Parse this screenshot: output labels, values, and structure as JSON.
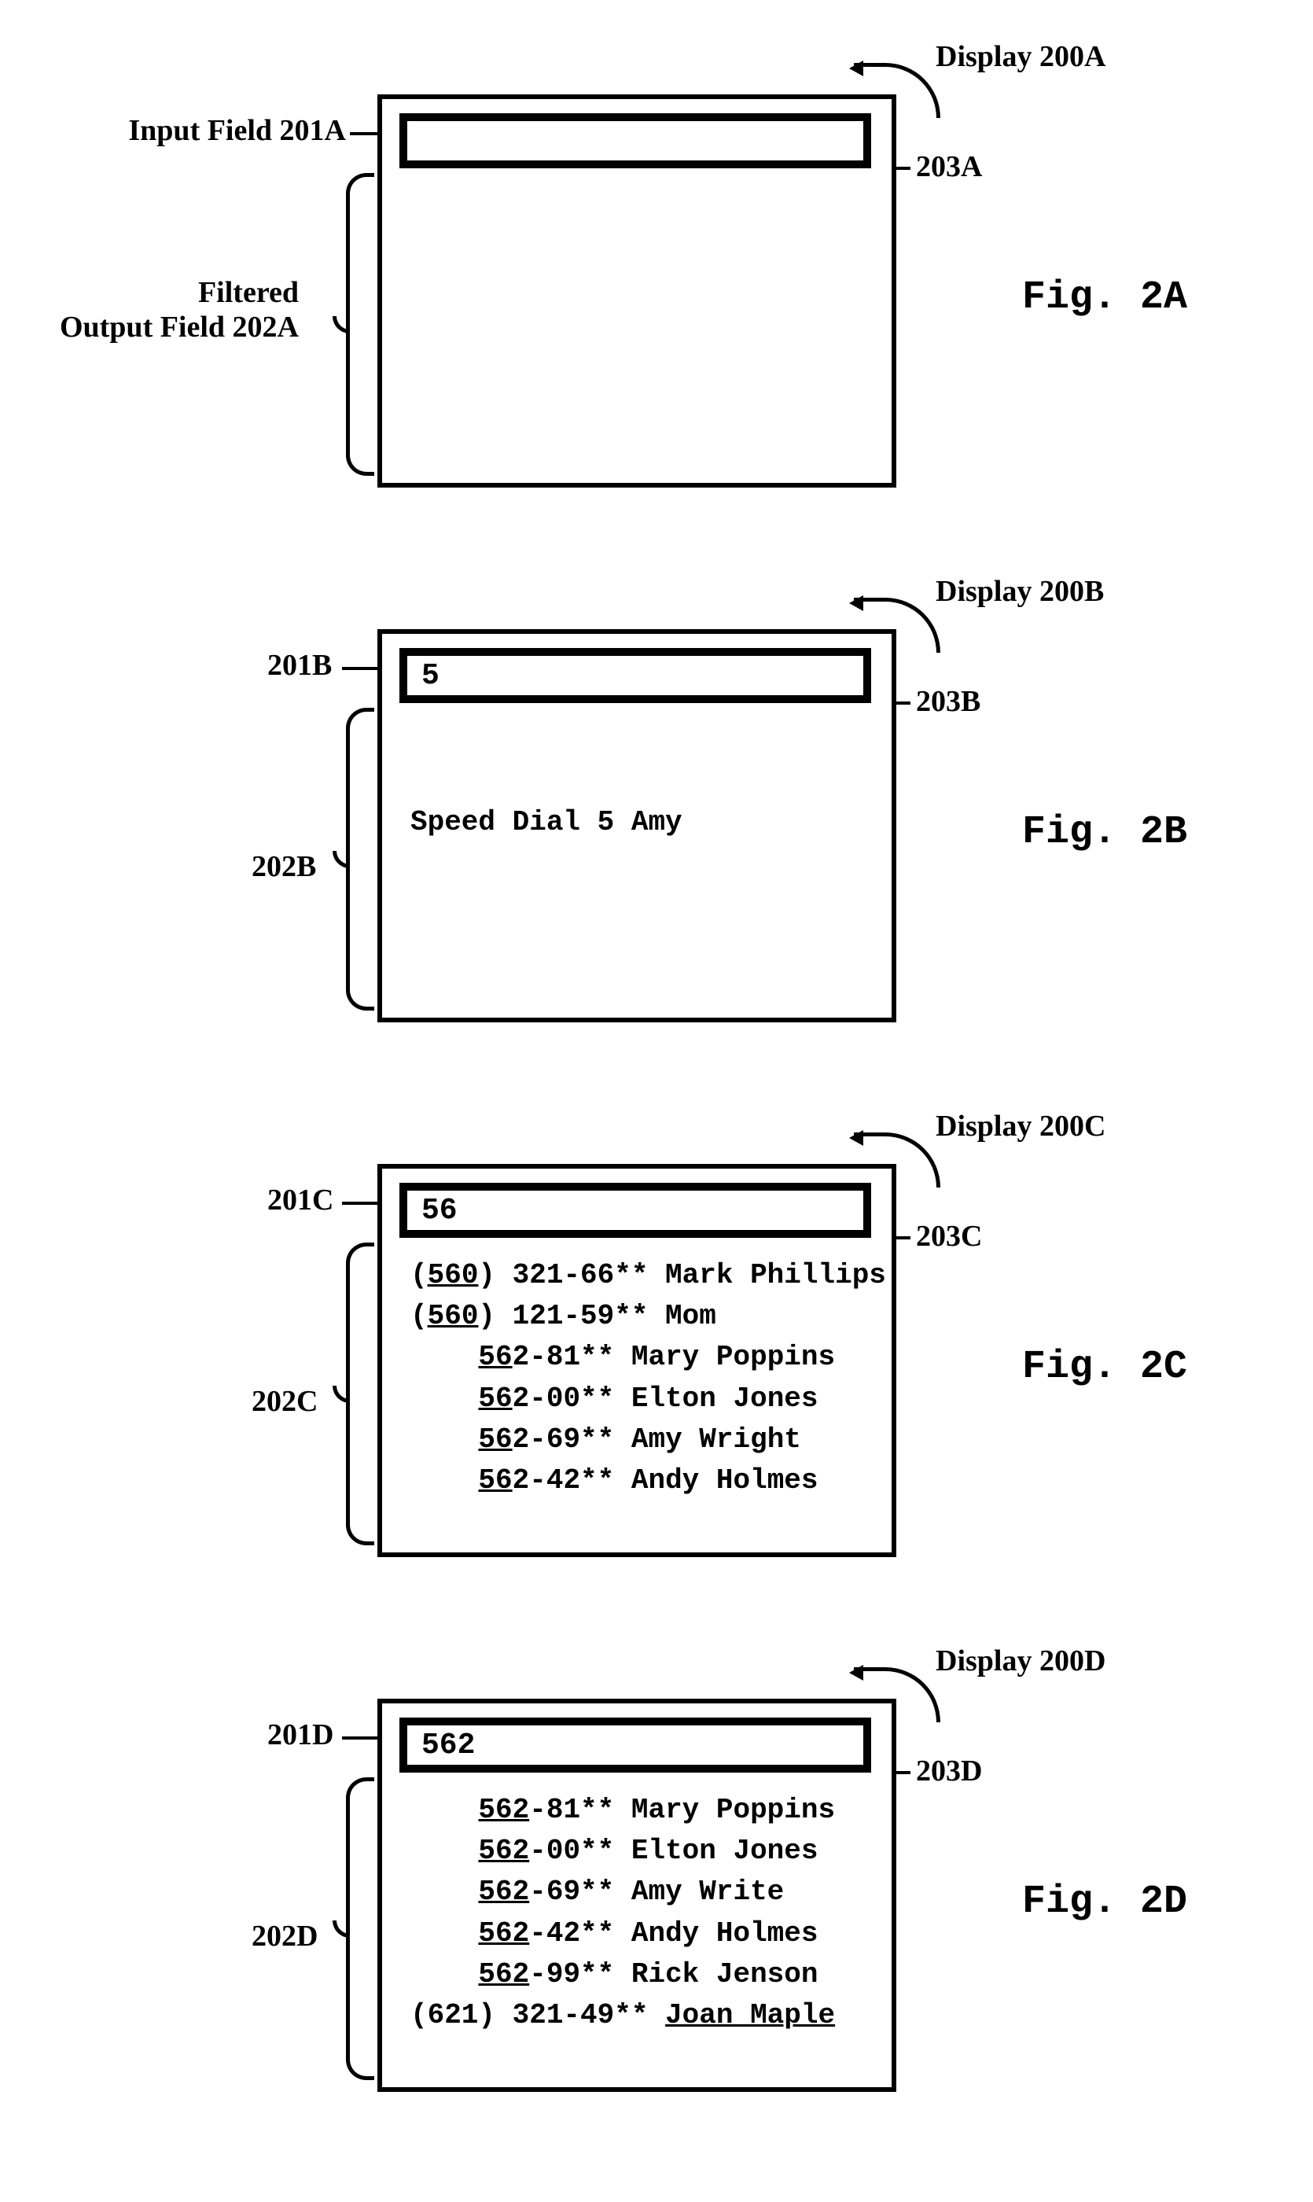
{
  "figs": {
    "A": {
      "display": "Display 200A",
      "input_label": "Input Field 201A",
      "output_label": "Filtered\nOutput Field 202A",
      "cursor_label": "203A",
      "title": "Fig. 2A",
      "value": ""
    },
    "B": {
      "display": "Display 200B",
      "input_label": "201B",
      "output_label": "202B",
      "cursor_label": "203B",
      "title": "Fig. 2B",
      "value": "5",
      "row0": "Speed Dial 5 Amy"
    },
    "C": {
      "display": "Display 200C",
      "input_label": "201C",
      "output_label": "202C",
      "cursor_label": "203C",
      "title": "Fig. 2C",
      "value": "56",
      "rows": [
        {
          "pre": "(",
          "u": "560",
          "post": ") 321-66** Mark Phillips"
        },
        {
          "pre": "(",
          "u": "560",
          "post": ") 121-59** Mom"
        },
        {
          "pre": "    ",
          "u": "56",
          "post": "2-81** Mary Poppins"
        },
        {
          "pre": "    ",
          "u": "56",
          "post": "2-00** Elton Jones"
        },
        {
          "pre": "    ",
          "u": "56",
          "post": "2-69** Amy Wright"
        },
        {
          "pre": "    ",
          "u": "56",
          "post": "2-42** Andy Holmes"
        }
      ]
    },
    "D": {
      "display": "Display 200D",
      "input_label": "201D",
      "output_label": "202D",
      "cursor_label": "203D",
      "title": "Fig. 2D",
      "value": "562",
      "rows": [
        {
          "pre": "    ",
          "u": "562",
          "post": "-81** Mary Poppins"
        },
        {
          "pre": "    ",
          "u": "562",
          "post": "-00** Elton Jones"
        },
        {
          "pre": "    ",
          "u": "562",
          "post": "-69** Amy Write"
        },
        {
          "pre": "    ",
          "u": "562",
          "post": "-42** Andy Holmes"
        },
        {
          "pre": "    ",
          "u": "562",
          "post": "-99** Rick Jenson"
        }
      ],
      "last_row": {
        "pre": "(621) 321-49** ",
        "u": "Joan Maple",
        "post": ""
      }
    }
  }
}
